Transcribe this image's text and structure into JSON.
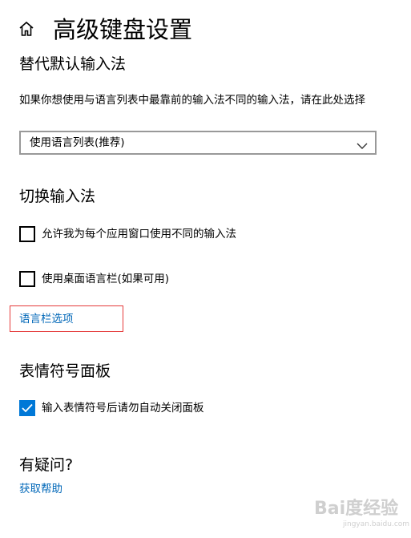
{
  "header": {
    "title": "高级键盘设置",
    "home_icon": "home-icon"
  },
  "override_input": {
    "heading": "替代默认输入法",
    "description": "如果你想使用与语言列表中最靠前的输入法不同的输入法，请在此处选择",
    "select_value": "使用语言列表(推荐)"
  },
  "switch_input": {
    "heading": "切换输入法",
    "per_app_checkbox": {
      "label": "允许我为每个应用窗口使用不同的输入法",
      "checked": false
    },
    "language_bar_checkbox": {
      "label": "使用桌面语言栏(如果可用)",
      "checked": false
    },
    "language_bar_options_link": "语言栏选项"
  },
  "emoji_panel": {
    "heading": "表情符号面板",
    "auto_close_checkbox": {
      "label": "输入表情符号后请勿自动关闭面板",
      "checked": true
    }
  },
  "help": {
    "heading": "有疑问?",
    "get_help_link": "获取帮助"
  },
  "watermark": {
    "text": "Bai度经验",
    "subtext": "jingyan.baidu.com"
  },
  "colors": {
    "accent": "#0078d7",
    "link": "#0067b8",
    "highlight": "#e53b3b"
  }
}
